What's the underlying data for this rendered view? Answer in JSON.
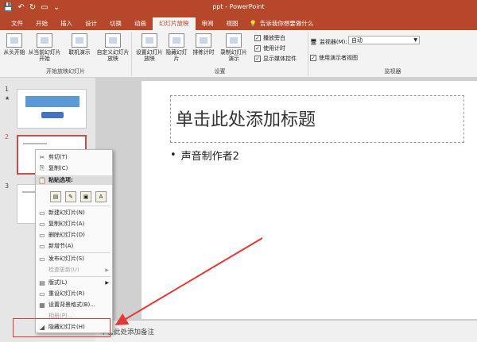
{
  "titlebar": {
    "title": "ppt - PowerPoint"
  },
  "tabs": [
    "文件",
    "开始",
    "插入",
    "设计",
    "切换",
    "动画",
    "幻灯片放映",
    "审阅",
    "视图"
  ],
  "active_tab_index": 6,
  "tell_me": "告诉我你想要做什么",
  "ribbon": {
    "start_group": {
      "label": "开始放映幻灯片",
      "from_beginning": "从头开始",
      "from_current": "从当前幻灯片开始",
      "online": "联机演示",
      "custom": "自定义幻灯片放映"
    },
    "setup_group": {
      "label": "设置",
      "setup": "设置幻灯片放映",
      "hide": "隐藏幻灯片",
      "rehearse": "排练计时",
      "record": "录制幻灯片演示",
      "play_narration": "播放旁白",
      "use_timings": "使用计时",
      "show_media": "显示媒体控件"
    },
    "monitor_group": {
      "label": "监视器",
      "monitor_label": "监视器(M):",
      "monitor_value": "自动",
      "presenter_view": "使用演示者视图"
    }
  },
  "thumbnails": {
    "numbers": [
      "1",
      "2",
      "3"
    ],
    "star": "★"
  },
  "slide": {
    "title_placeholder": "单击此处添加标题",
    "bullet": "声音制作者2"
  },
  "notes": {
    "placeholder": "单击此处添加备注"
  },
  "context_menu": {
    "cut": "剪切(T)",
    "copy": "复制(C)",
    "paste_options": "粘贴选项:",
    "new_slide": "新建幻灯片(N)",
    "duplicate": "复制幻灯片(A)",
    "delete": "删除幻灯片(D)",
    "new_section": "新增节(A)",
    "publish": "发布幻灯片(S)",
    "check_updates": "检查更新(U)",
    "layout": "版式(L)",
    "reset": "重设幻灯片(R)",
    "format_bg": "设置背景格式(B)...",
    "photo_album": "相册(P)...",
    "hide_slide": "隐藏幻灯片(H)"
  },
  "colors": {
    "accent": "#b7472a",
    "annotation": "#e53935"
  }
}
